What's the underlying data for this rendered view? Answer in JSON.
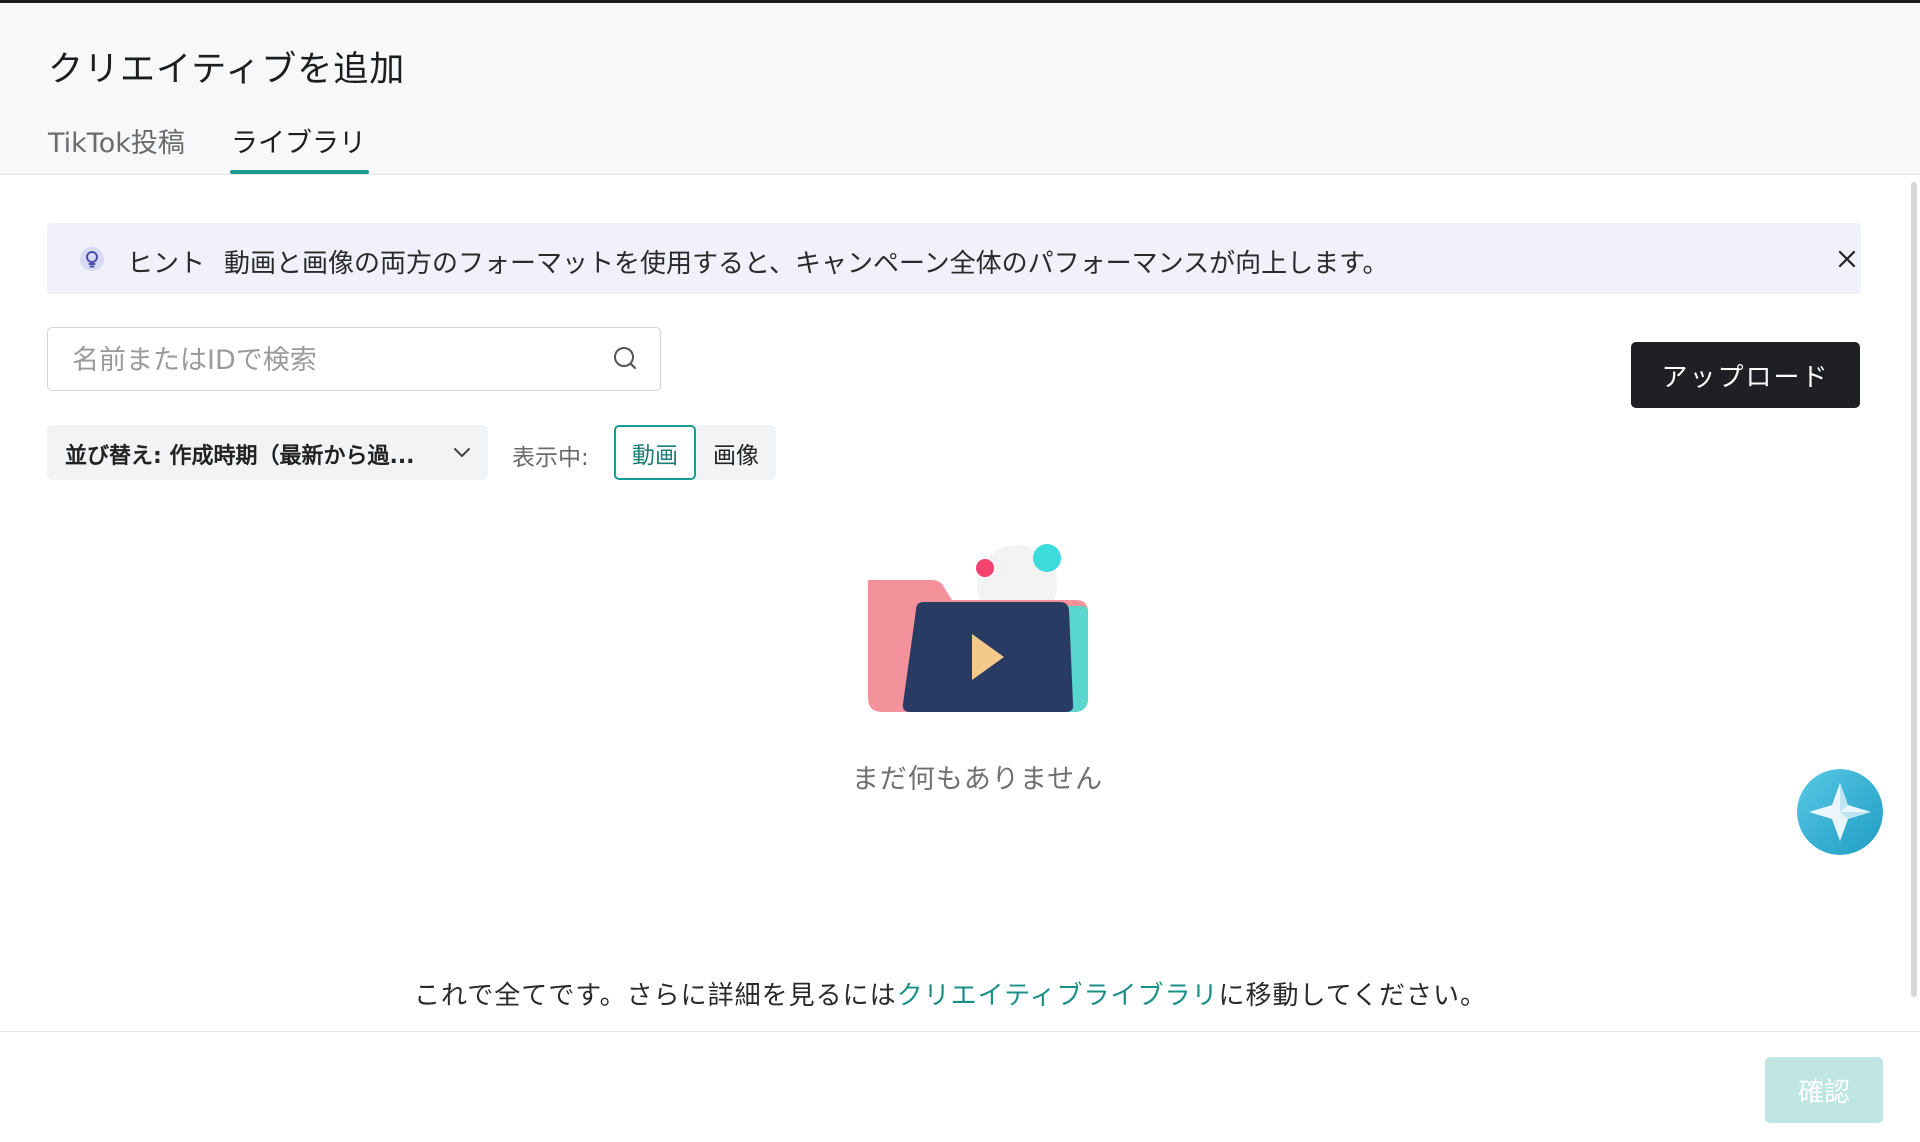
{
  "dialog": {
    "title": "クリエイティブを追加",
    "tabs": [
      {
        "label": "TikTok投稿",
        "active": false
      },
      {
        "label": "ライブラリ",
        "active": true
      }
    ]
  },
  "hint": {
    "label": "ヒント",
    "text": "動画と画像の両方のフォーマットを使用すると、キャンペーン全体のパフォーマンスが向上します。",
    "icon": "lightbulb-icon"
  },
  "search": {
    "placeholder": "名前またはIDで検索",
    "value": ""
  },
  "upload_label": "アップロード",
  "sort": {
    "label": "並び替え: 作成時期（最新から過..."
  },
  "filter": {
    "showing_label": "表示中:",
    "options": [
      {
        "label": "動画",
        "selected": true
      },
      {
        "label": "画像",
        "selected": false
      }
    ]
  },
  "empty_state": {
    "text": "まだ何もありません"
  },
  "footer": {
    "prefix": "これで全てです。さらに詳細を見るには",
    "link": "クリエイティブライブラリ",
    "suffix": "に移動してください。"
  },
  "confirm_label": "確認",
  "colors": {
    "accent": "#1a9c94",
    "confirm_disabled": "#bfe6e3",
    "upload_bg": "#1f2023"
  }
}
